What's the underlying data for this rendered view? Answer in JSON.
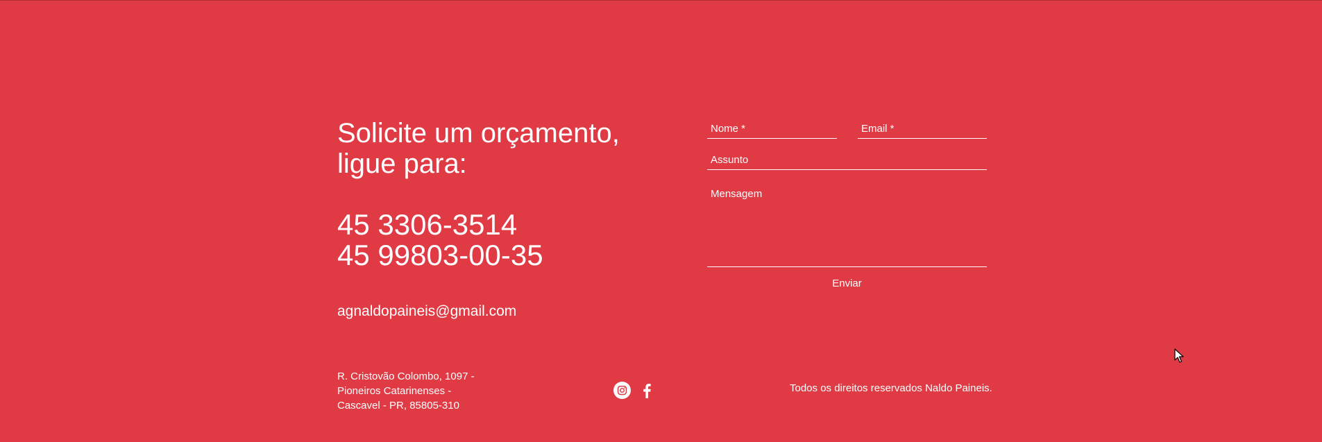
{
  "contact": {
    "heading": "Solicite um orçamento,\nligue para:",
    "phone_1": "45 3306-3514",
    "phone_2": "45 99803-00-35",
    "email": "agnaldopaineis@gmail.com"
  },
  "form": {
    "name_placeholder": "Nome *",
    "email_placeholder": "Email *",
    "subject_placeholder": "Assunto",
    "message_placeholder": "Mensagem",
    "submit_label": "Enviar"
  },
  "footer": {
    "address_line_1": "R. Cristovão Colombo, 1097 -",
    "address_line_2": "Pioneiros Catarinenses -",
    "address_line_3": "Cascavel - PR, 85805-310",
    "social_icons": [
      "instagram-icon",
      "facebook-icon"
    ],
    "copyright": "Todos os direitos reservados Naldo Paineis."
  },
  "theme": {
    "background": "#e03a45",
    "text": "#ffffff"
  }
}
